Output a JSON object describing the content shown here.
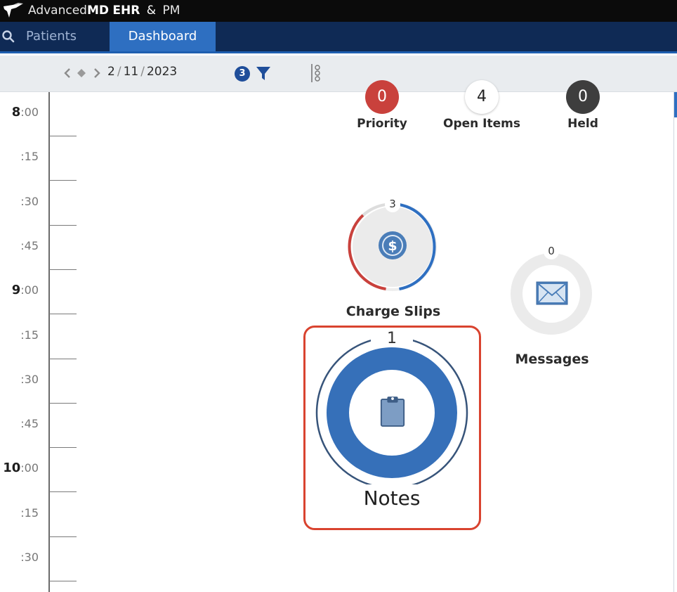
{
  "app": {
    "brand_light": "Advanced",
    "brand_bold": "MD",
    "brand_ehr": "EHR",
    "brand_amp": "&",
    "brand_pm": "PM",
    "logo_icon": "eagle-logo-icon"
  },
  "nav": {
    "search_icon": "search-icon",
    "tabs": [
      {
        "label": "Patients"
      },
      {
        "label": "Dashboard",
        "active": true
      }
    ]
  },
  "toolbar": {
    "date": {
      "month": "2",
      "sep": "/",
      "day": "11",
      "year": "2023"
    },
    "filter_count": "3"
  },
  "timeline": {
    "slots": [
      {
        "hour": "8",
        "min": ":00"
      },
      {
        "hour": "",
        "min": ":15"
      },
      {
        "hour": "",
        "min": ":30"
      },
      {
        "hour": "",
        "min": ":45"
      },
      {
        "hour": "9",
        "min": ":00"
      },
      {
        "hour": "",
        "min": ":15"
      },
      {
        "hour": "",
        "min": ":30"
      },
      {
        "hour": "",
        "min": ":45"
      },
      {
        "hour": "10",
        "min": ":00"
      },
      {
        "hour": "",
        "min": ":15"
      },
      {
        "hour": "",
        "min": ":30"
      }
    ]
  },
  "counters": {
    "priority": {
      "value": "0",
      "label": "Priority"
    },
    "open_items": {
      "value": "4",
      "label": "Open Items"
    },
    "held": {
      "value": "0",
      "label": "Held"
    }
  },
  "widgets": {
    "charge_slips": {
      "count": "3",
      "label": "Charge Slips",
      "icon": "dollar-icon"
    },
    "messages": {
      "count": "0",
      "label": "Messages",
      "icon": "envelope-icon"
    },
    "notes": {
      "count": "1",
      "label": "Notes",
      "icon": "clipboard-icon",
      "highlighted": true
    }
  },
  "colors": {
    "accent_blue": "#2e6fc1",
    "nav_dark": "#0f2a55",
    "priority_red": "#c9413c",
    "held_gray": "#3e3e3e",
    "highlight_red": "#d9432f"
  }
}
